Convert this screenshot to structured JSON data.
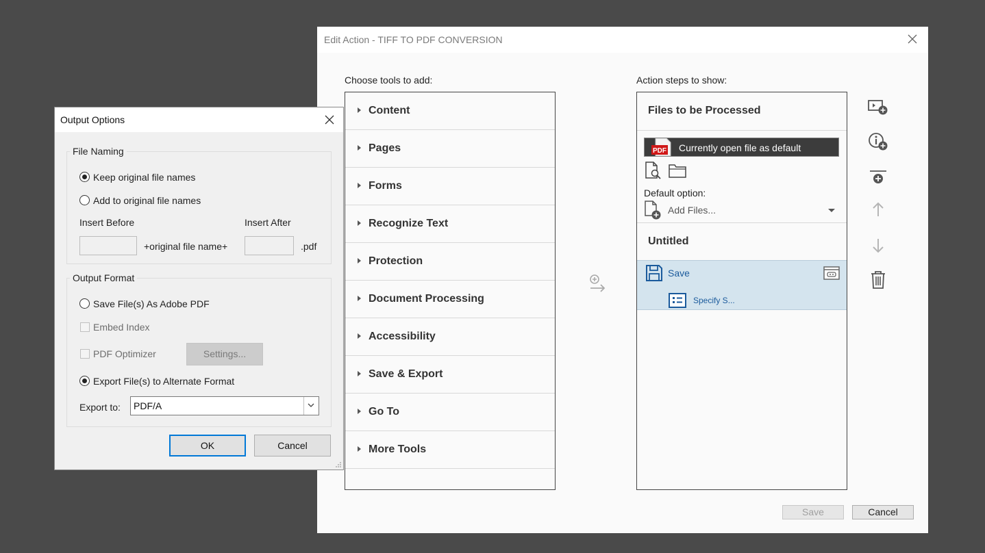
{
  "edit_action": {
    "title": "Edit Action - TIFF TO PDF CONVERSION",
    "choose_tools_label": "Choose tools to add:",
    "action_steps_label": "Action steps to show:",
    "tools": [
      "Content",
      "Pages",
      "Forms",
      "Recognize Text",
      "Protection",
      "Document Processing",
      "Accessibility",
      "Save & Export",
      "Go To",
      "More Tools"
    ],
    "steps": {
      "files_header": "Files to be Processed",
      "current_file": "Currently open file as default",
      "pdf_badge": "PDF",
      "default_option_label": "Default option:",
      "add_files": "Add Files...",
      "untitled_header": "Untitled",
      "save_step": "Save",
      "specify_step": "Specify S..."
    },
    "save_button": "Save",
    "cancel_button": "Cancel"
  },
  "output_options": {
    "title": "Output Options",
    "file_naming": {
      "legend": "File Naming",
      "keep_original": "Keep original file names",
      "add_to_original": "Add to original file names",
      "insert_before": "Insert Before",
      "insert_after": "Insert After",
      "original_file_name": "+original file name+",
      "extension": ".pdf",
      "selected": "keep_original"
    },
    "output_format": {
      "legend": "Output Format",
      "save_as_pdf": "Save File(s) As Adobe PDF",
      "embed_index": "Embed Index",
      "pdf_optimizer": "PDF Optimizer",
      "settings_button": "Settings...",
      "export_alternate": "Export File(s) to Alternate Format",
      "export_to_label": "Export to:",
      "export_to_value": "PDF/A",
      "selected": "export_alternate"
    },
    "ok_button": "OK",
    "cancel_button": "Cancel"
  },
  "colors": {
    "background": "#4a4a4a",
    "accent_blue": "#1a5a9c",
    "selected_step": "#d4e4ee",
    "focus_border": "#0078d7",
    "pdf_red": "#d01818"
  }
}
